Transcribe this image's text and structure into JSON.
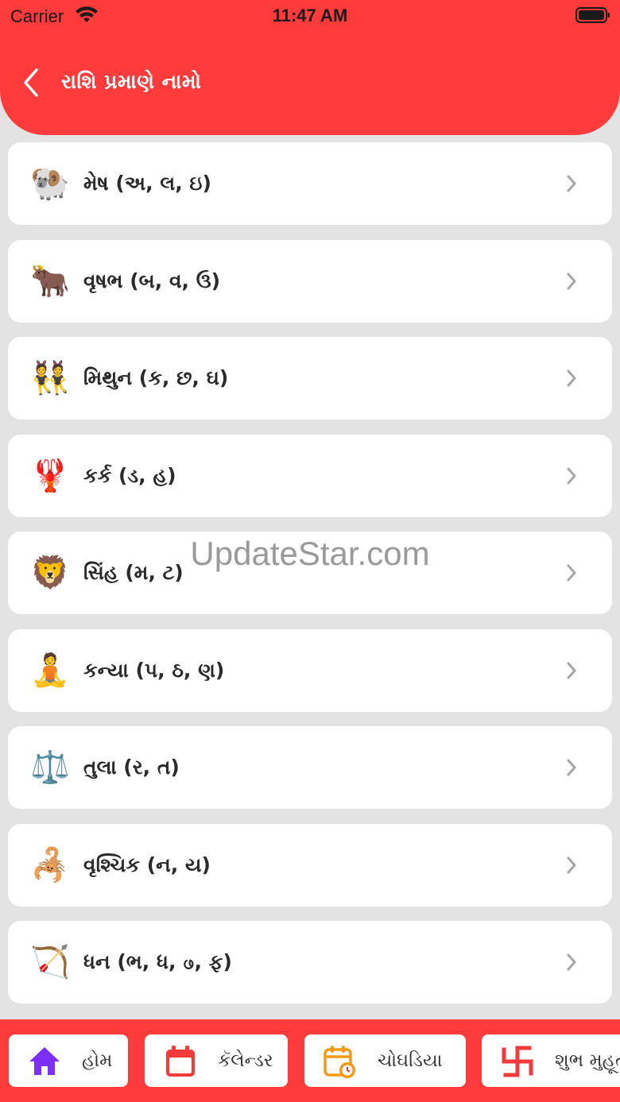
{
  "status_bar": {
    "carrier": "Carrier",
    "time": "11:47 AM"
  },
  "header": {
    "title": "રાશિ પ્રમાણે નામો"
  },
  "rashi_list": [
    {
      "icon": "aries-ram-icon",
      "emoji": "🐏",
      "label": "મેષ (અ, લ, ઇ)"
    },
    {
      "icon": "taurus-ox-icon",
      "emoji": "🐂",
      "label": "વૃષભ (બ, વ, ઉ)"
    },
    {
      "icon": "gemini-twins-icon",
      "emoji": "👯",
      "label": "મિથુન (ક, છ, ઘ)"
    },
    {
      "icon": "cancer-crab-icon",
      "emoji": "🦞",
      "label": "કર્ક (ડ, હ)"
    },
    {
      "icon": "leo-lion-icon",
      "emoji": "🦁",
      "label": "સિંહ (મ, ટ)"
    },
    {
      "icon": "virgo-maiden-icon",
      "emoji": "🧘",
      "label": "કન્યા (પ, ઠ, ણ)"
    },
    {
      "icon": "libra-scales-icon",
      "emoji": "⚖️",
      "label": "તુલા (ર, ત)"
    },
    {
      "icon": "scorpio-scorpion-icon",
      "emoji": "🦂",
      "label": "વૃશ્ચિક (ન, ય)"
    },
    {
      "icon": "sagittarius-archer-icon",
      "emoji": "🏹",
      "label": "ધન (ભ, ધ, ဖ, ફ)"
    }
  ],
  "watermark": "UpdateStar.com",
  "tabs": [
    {
      "icon": "home-icon",
      "label": "હોમ"
    },
    {
      "icon": "calendar-icon",
      "label": "કૅલેન્ડર"
    },
    {
      "icon": "choghadiya-icon",
      "label": "ચોઘડિયા"
    },
    {
      "icon": "swastik-icon",
      "label": "શુભ મુહૂર્ત"
    }
  ],
  "colors": {
    "accent": "#ff3b3b",
    "background": "#e3e3e3",
    "card": "#ffffff",
    "home_icon": "#7b2ff7",
    "calendar_icon": "#f23b3b",
    "choghadiya_icon": "#f59a18"
  }
}
